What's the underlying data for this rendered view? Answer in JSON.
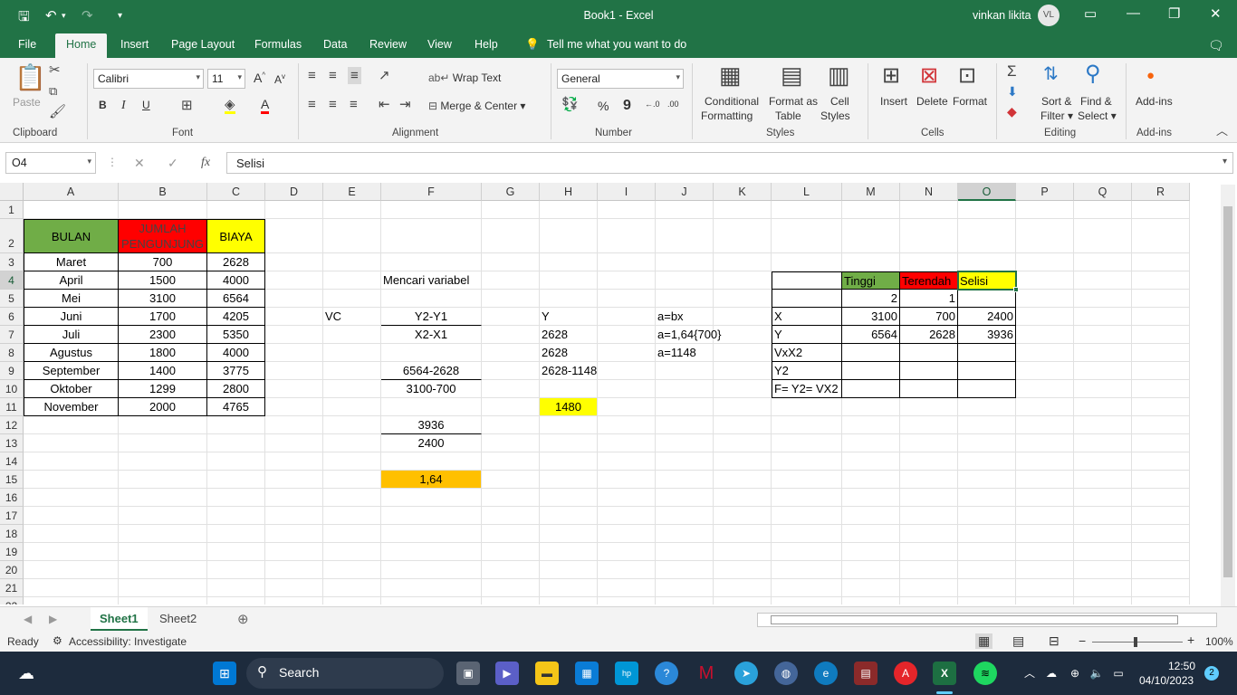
{
  "titlebar": {
    "title": "Book1  -  Excel",
    "user": "vinkan likita",
    "avatar": "VL"
  },
  "menu": {
    "file": "File",
    "tabs": [
      "Home",
      "Insert",
      "Page Layout",
      "Formulas",
      "Data",
      "Review",
      "View",
      "Help"
    ],
    "tellme": "Tell me what you want to do"
  },
  "ribbon": {
    "clipboard": {
      "paste": "Paste",
      "label": "Clipboard"
    },
    "font": {
      "name": "Calibri",
      "size": "11",
      "label": "Font",
      "bold": "B",
      "italic": "I",
      "underline": "U"
    },
    "alignment": {
      "wrap": "Wrap Text",
      "merge": "Merge & Center",
      "label": "Alignment"
    },
    "number": {
      "format": "General",
      "percent": "%",
      "comma": "9",
      "label": "Number"
    },
    "styles": {
      "conditional": "Conditional",
      "conditional2": "Formatting",
      "format_table": "Format as",
      "format_table2": "Table",
      "cell_styles": "Cell",
      "cell_styles2": "Styles",
      "label": "Styles"
    },
    "cells": {
      "insert": "Insert",
      "delete": "Delete",
      "format": "Format",
      "label": "Cells"
    },
    "editing": {
      "sort": "Sort &",
      "sort2": "Filter",
      "find": "Find &",
      "find2": "Select",
      "label": "Editing"
    },
    "addins": {
      "addins": "Add-ins",
      "label": "Add-ins"
    }
  },
  "formula_bar": {
    "name_box": "O4",
    "value": "Selisi"
  },
  "columns": [
    "A",
    "B",
    "C",
    "D",
    "E",
    "F",
    "G",
    "H",
    "I",
    "J",
    "K",
    "L",
    "M",
    "N",
    "O",
    "P",
    "Q",
    "R"
  ],
  "rows": [
    "1",
    "2",
    "3",
    "4",
    "5",
    "6",
    "7",
    "8",
    "9",
    "10",
    "11",
    "12",
    "13",
    "14",
    "15",
    "16",
    "17",
    "18",
    "19",
    "20",
    "21",
    "22"
  ],
  "cells": {
    "A2": "BULAN",
    "B2": "JUMLAH",
    "B2b": "PENGUNJUNG",
    "C2": "BIAYA",
    "A3": "Maret",
    "B3": "700",
    "C3": "2628",
    "A4": "April",
    "B4": "1500",
    "C4": "4000",
    "A5": "Mei",
    "B5": "3100",
    "C5": "6564",
    "A6": "Juni",
    "B6": "1700",
    "C6": "4205",
    "A7": "Juli",
    "B7": "2300",
    "C7": "5350",
    "A8": "Agustus",
    "B8": "1800",
    "C8": "4000",
    "A9": "September",
    "B9": "1400",
    "C9": "3775",
    "A10": "Oktober",
    "B10": "1299",
    "C10": "2800",
    "A11": "November",
    "B11": "2000",
    "C11": "4765",
    "E6": "VC",
    "F4": "Mencari variabel",
    "F6": "Y2-Y1",
    "F7": "X2-X1",
    "F9": "6564-2628",
    "F10": "3100-700",
    "F12": "3936",
    "F13": "2400",
    "F15": "1,64",
    "H6": "Y",
    "H7": "2628",
    "H8": "2628",
    "H9": "2628-1148",
    "H11": "1480",
    "J6": "a=bx",
    "J7": "a=1,64{700}",
    "J8": "a=1148",
    "L6": "X",
    "L7": "Y",
    "L8": "VxX2",
    "L9": "Y2",
    "L10": "F= Y2= VX2",
    "M4": "Tinggi",
    "N4": "Terendah",
    "O4": "Selisi",
    "M5": "2",
    "N5": "1",
    "M6": "3100",
    "N6": "700",
    "O6": "2400",
    "M7": "6564",
    "N7": "2628",
    "O7": "3936"
  },
  "sheets": [
    "Sheet1",
    "Sheet2"
  ],
  "status": {
    "ready": "Ready",
    "accessibility": "Accessibility: Investigate",
    "zoom": "100%"
  },
  "taskbar": {
    "search": "Search",
    "time": "12:50",
    "date": "04/10/2023",
    "badge": "2"
  },
  "colors": {
    "excel_green": "#217346",
    "header_green": "#70ad47",
    "red": "#ff0000",
    "yellow": "#ffff00",
    "orange": "#ffc000"
  }
}
